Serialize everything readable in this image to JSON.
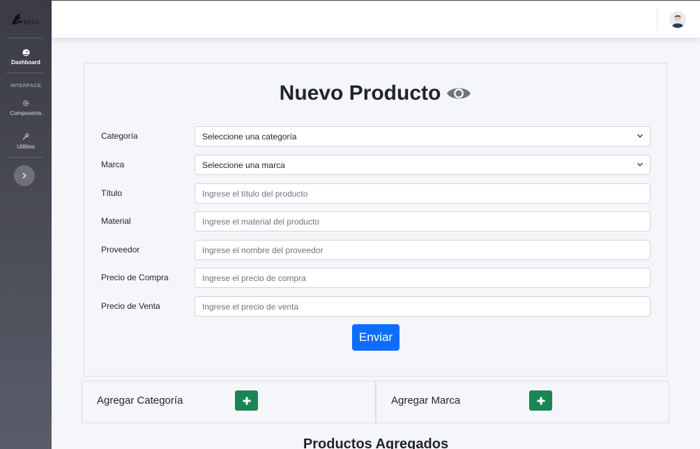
{
  "sidebar": {
    "brand": "FREYA",
    "items": [
      {
        "label": "Dashboard",
        "icon": "gauge-icon",
        "active": true
      },
      {
        "label": "Components",
        "icon": "gear-icon"
      },
      {
        "label": "Utilities",
        "icon": "wrench-icon"
      }
    ],
    "heading": "INTERFACE"
  },
  "form": {
    "title": "Nuevo Producto",
    "title_icon": "eye-icon",
    "fields": [
      {
        "label": "Categoría",
        "type": "select",
        "value": "Seleccione una categoría"
      },
      {
        "label": "Marca",
        "type": "select",
        "value": "Seleccione una marca"
      },
      {
        "label": "Título",
        "type": "input",
        "placeholder": "Ingrese el título del producto"
      },
      {
        "label": "Material",
        "type": "input",
        "placeholder": "Ingrese el material del producto"
      },
      {
        "label": "Proveedor",
        "type": "input",
        "placeholder": "Ingrese el nombre del proveedor"
      },
      {
        "label": "Precio de Compra",
        "type": "input",
        "placeholder": "Ingrese el precio de compra"
      },
      {
        "label": "Precio de Venta",
        "type": "input",
        "placeholder": "Ingrese el precio de venta"
      }
    ],
    "submit_label": "Enviar"
  },
  "add_category": {
    "label": "Agregar Categoría"
  },
  "add_brand": {
    "label": "Agregar Marca"
  },
  "products_heading": "Productos Agregados",
  "colors": {
    "primary": "#0d6efd",
    "success": "#198754",
    "sidebar_top": "#3a3b45",
    "sidebar_bottom": "#5a5c69"
  }
}
